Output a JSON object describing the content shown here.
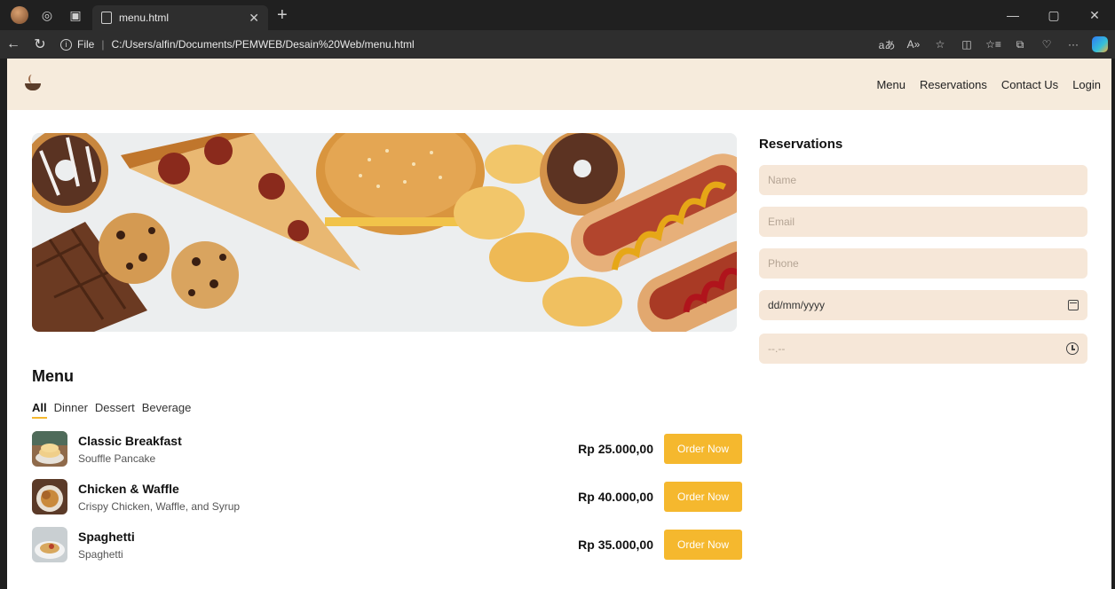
{
  "browser": {
    "tab_title": "menu.html",
    "url_scheme": "File",
    "url_path": "C:/Users/alfin/Documents/PEMWEB/Desain%20Web/menu.html"
  },
  "navbar": {
    "links": [
      "Menu",
      "Reservations",
      "Contact Us",
      "Login"
    ]
  },
  "menu": {
    "title": "Menu",
    "categories": [
      "All",
      "Dinner",
      "Dessert",
      "Beverage"
    ],
    "active_category": "All",
    "items": [
      {
        "name": "Classic Breakfast",
        "desc": "Souffle Pancake",
        "price": "Rp 25.000,00",
        "button": "Order Now"
      },
      {
        "name": "Chicken & Waffle",
        "desc": "Crispy Chicken, Waffle, and Syrup",
        "price": "Rp 40.000,00",
        "button": "Order Now"
      },
      {
        "name": "Spaghetti",
        "desc": "Spaghetti",
        "price": "Rp 35.000,00",
        "button": "Order Now"
      }
    ]
  },
  "reservations": {
    "title": "Reservations",
    "name_placeholder": "Name",
    "email_placeholder": "Email",
    "phone_placeholder": "Phone",
    "date_placeholder": "dd/mm/yyyy",
    "time_placeholder": "--.--"
  },
  "colors": {
    "accent": "#f5b82e",
    "navbar_bg": "#f6ebdc",
    "field_bg": "#f6e7d8"
  }
}
